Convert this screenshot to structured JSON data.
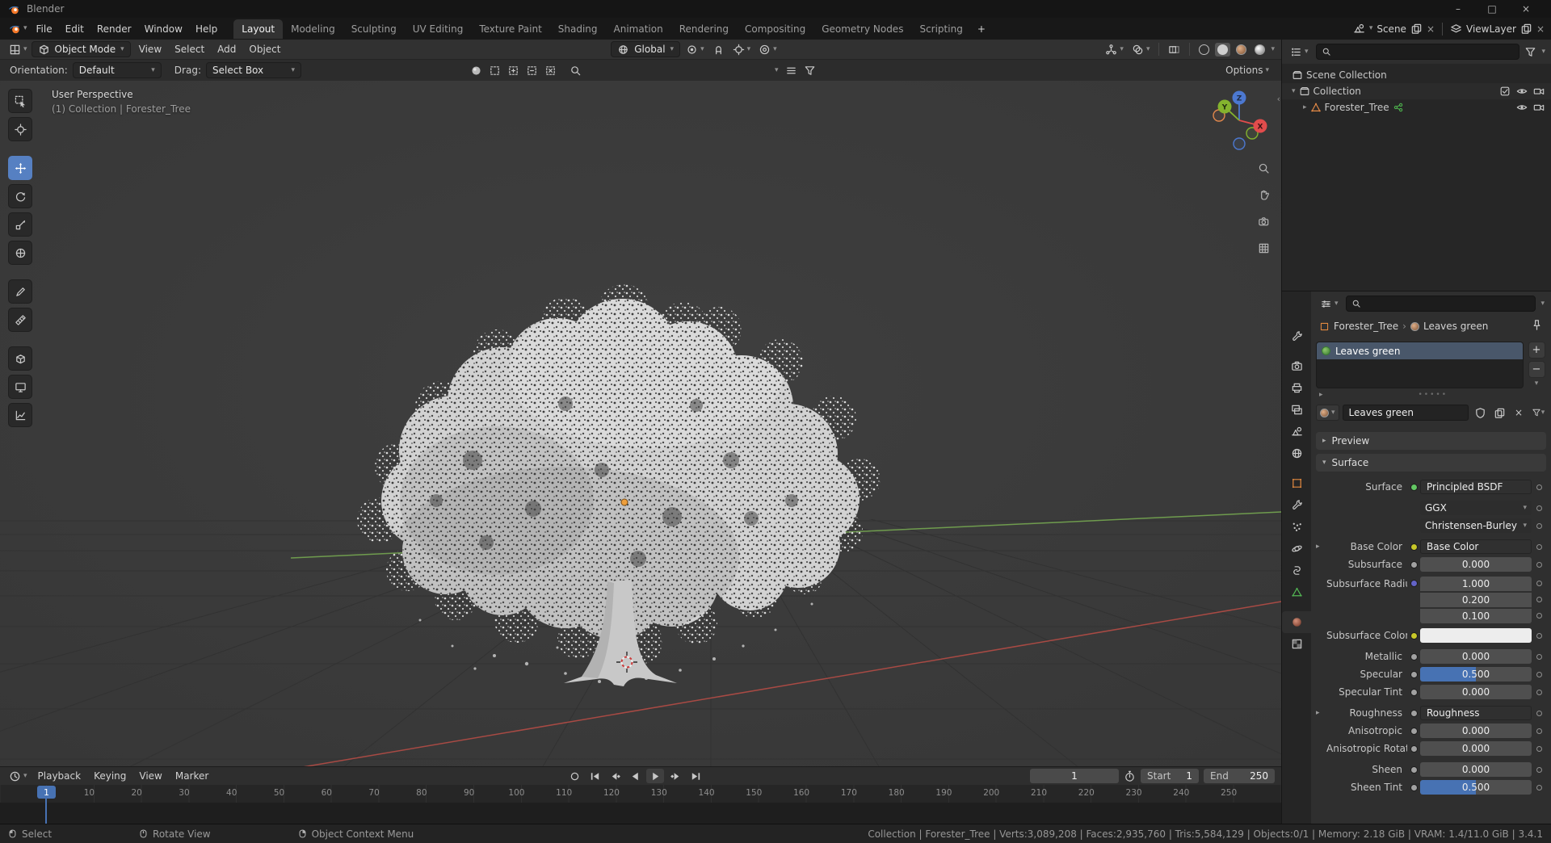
{
  "window": {
    "title": "Blender",
    "controls": {
      "minimize": "–",
      "maximize": "□",
      "close": "×"
    }
  },
  "topbar": {
    "menus": [
      "File",
      "Edit",
      "Render",
      "Window",
      "Help"
    ],
    "workspaces": [
      {
        "label": "Layout",
        "active": true
      },
      {
        "label": "Modeling"
      },
      {
        "label": "Sculpting"
      },
      {
        "label": "UV Editing"
      },
      {
        "label": "Texture Paint"
      },
      {
        "label": "Shading"
      },
      {
        "label": "Animation"
      },
      {
        "label": "Rendering"
      },
      {
        "label": "Compositing"
      },
      {
        "label": "Geometry Nodes"
      },
      {
        "label": "Scripting"
      }
    ],
    "add_workspace": "+",
    "scene": "Scene",
    "view_layer": "ViewLayer"
  },
  "viewport": {
    "header": {
      "mode": "Object Mode",
      "menus": [
        "View",
        "Select",
        "Add",
        "Object"
      ],
      "orientation": "Global",
      "options": "Options"
    },
    "tool_settings": {
      "orientation_label": "Orientation:",
      "orientation_value": "Default",
      "drag_label": "Drag:",
      "drag_value": "Select Box"
    },
    "overlay": {
      "line1": "User Perspective",
      "line2": "(1) Collection | Forester_Tree"
    },
    "gizmo": {
      "x": "X",
      "y": "Y",
      "z": "Z"
    },
    "tools": [
      "select-box",
      "cursor",
      "move",
      "rotate",
      "scale",
      "transform",
      "annotate",
      "measure",
      "add-cube",
      "addon-tool-1",
      "addon-tool-2"
    ],
    "active_tool": "move"
  },
  "outliner": {
    "rows": [
      {
        "label": "Scene Collection"
      },
      {
        "label": "Collection"
      },
      {
        "label": "Forester_Tree"
      }
    ]
  },
  "properties": {
    "tabs": [
      "tool",
      "render",
      "output",
      "view-layer",
      "scene",
      "world",
      "object",
      "modifiers",
      "particles",
      "physics",
      "constraints",
      "object-data",
      "material",
      "texture"
    ],
    "active_tab": "material",
    "breadcrumb": {
      "object": "Forester_Tree",
      "separator": "›",
      "material": "Leaves green"
    },
    "slot_name": "Leaves green",
    "material_name": "Leaves green",
    "preview_label": "Preview",
    "surface_label": "Surface",
    "rows": {
      "surface": {
        "label": "Surface",
        "value": "Principled BSDF"
      },
      "distribution": "GGX",
      "subsurface_method": "Christensen-Burley",
      "base_color": {
        "label": "Base Color",
        "value": "Base Color"
      },
      "subsurface": {
        "label": "Subsurface",
        "value": "0.000"
      },
      "subsurface_radius": {
        "label": "Subsurface Radius",
        "values": [
          "1.000",
          "0.200",
          "0.100"
        ]
      },
      "subsurface_color": {
        "label": "Subsurface Color",
        "color": "#ededed"
      },
      "metallic": {
        "label": "Metallic",
        "value": "0.000"
      },
      "specular": {
        "label": "Specular",
        "value": "0.500"
      },
      "specular_tint": {
        "label": "Specular Tint",
        "value": "0.000"
      },
      "roughness": {
        "label": "Roughness",
        "value": "Roughness"
      },
      "anisotropic": {
        "label": "Anisotropic",
        "value": "0.000"
      },
      "anisotropic_rotation": {
        "label": "Anisotropic Rotat...",
        "value": "0.000"
      },
      "sheen": {
        "label": "Sheen",
        "value": "0.000"
      },
      "sheen_tint": {
        "label": "Sheen Tint",
        "value": "0.500"
      }
    }
  },
  "timeline": {
    "menus": [
      "Playback",
      "Keying",
      "View",
      "Marker"
    ],
    "current_frame": "1",
    "playhead": "1",
    "start_label": "Start",
    "start": "1",
    "end_label": "End",
    "end": "250",
    "ruler": [
      10,
      20,
      30,
      40,
      50,
      60,
      70,
      80,
      90,
      100,
      110,
      120,
      130,
      140,
      150,
      160,
      170,
      180,
      190,
      200,
      210,
      220,
      230,
      240,
      250
    ]
  },
  "statusbar": {
    "hints": [
      {
        "label": "Select"
      },
      {
        "label": "Rotate View"
      },
      {
        "label": "Object Context Menu"
      }
    ],
    "stats": "Collection | Forester_Tree | Verts:3,089,208 | Faces:2,935,760 | Tris:5,584,129 | Objects:0/1 | Memory: 2.18 GiB | VRAM: 1.4/11.0 GiB | 3.4.1"
  },
  "colors": {
    "accent": "#4772b3",
    "active_tool": "#5680c2",
    "axis_x": "#e24c4c",
    "axis_y": "#84b32e",
    "axis_z": "#4c78d0"
  }
}
